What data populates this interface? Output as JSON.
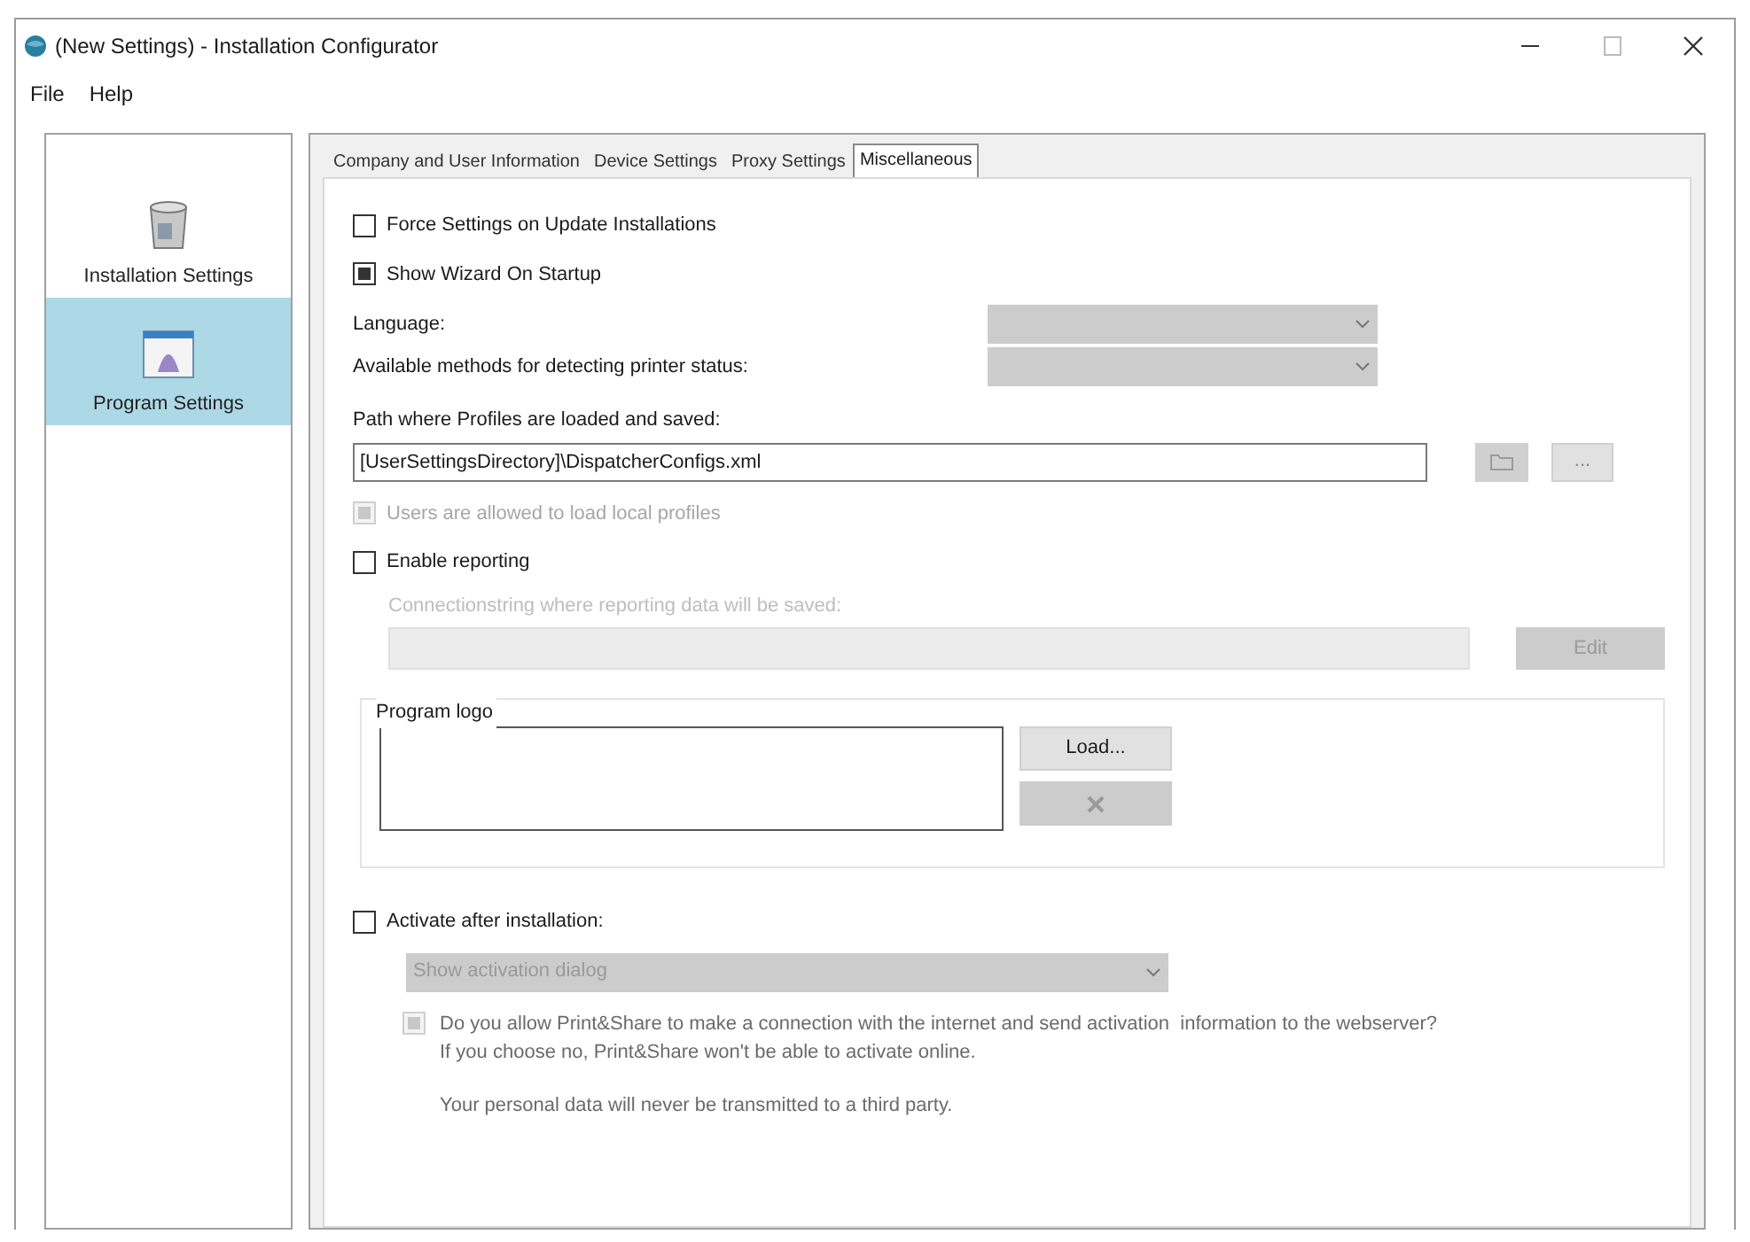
{
  "window": {
    "title": "(New Settings) - Installation Configurator"
  },
  "menu": [
    "File",
    "Help"
  ],
  "sidebar": {
    "items": [
      {
        "label": "Installation Settings",
        "kind": "installer",
        "selected": false
      },
      {
        "label": "Program Settings",
        "kind": "program",
        "selected": true
      }
    ]
  },
  "tabs": [
    {
      "label": "Company and User Information",
      "selected": false
    },
    {
      "label": "Device Settings",
      "selected": false
    },
    {
      "label": "Proxy Settings",
      "selected": false
    },
    {
      "label": "Miscellaneous",
      "selected": true
    }
  ],
  "force_settings": {
    "label": "Force Settings on Update Installations",
    "checked": false
  },
  "show_wizard": {
    "label": "Show Wizard On Startup",
    "checked": true
  },
  "language": {
    "label": "Language:",
    "disabled": true
  },
  "printer_status": {
    "label": "Available methods for detecting printer status:",
    "disabled": true
  },
  "profiles_path": {
    "label": "Path where Profiles are loaded and saved:",
    "value": "[UserSettingsDirectory]\\DispatcherConfigs.xml",
    "browse_button": "..."
  },
  "local_profiles": {
    "label": "Users are allowed to load local profiles",
    "checked": true,
    "disabled": true
  },
  "enable_reporting": {
    "label": "Enable reporting",
    "checked": false
  },
  "connection_string": {
    "label": "Connectionstring where reporting data will be saved:",
    "button": "Edit",
    "disabled": true
  },
  "program_logo": {
    "title": "Program logo",
    "load_button": "Load..."
  },
  "activate": {
    "label": "Activate after installation:",
    "checked": false
  },
  "activation_mode": {
    "value": "Show activation dialog",
    "disabled": true
  },
  "consent": {
    "checked": true,
    "disabled": true,
    "lines": [
      "Do you allow Print&Share to make a connection with the internet and send activation  information to the webserver?",
      "If you choose no, Print&Share won't be able to activate online."
    ],
    "note": "Your personal data will never be transmitted to a third party."
  }
}
